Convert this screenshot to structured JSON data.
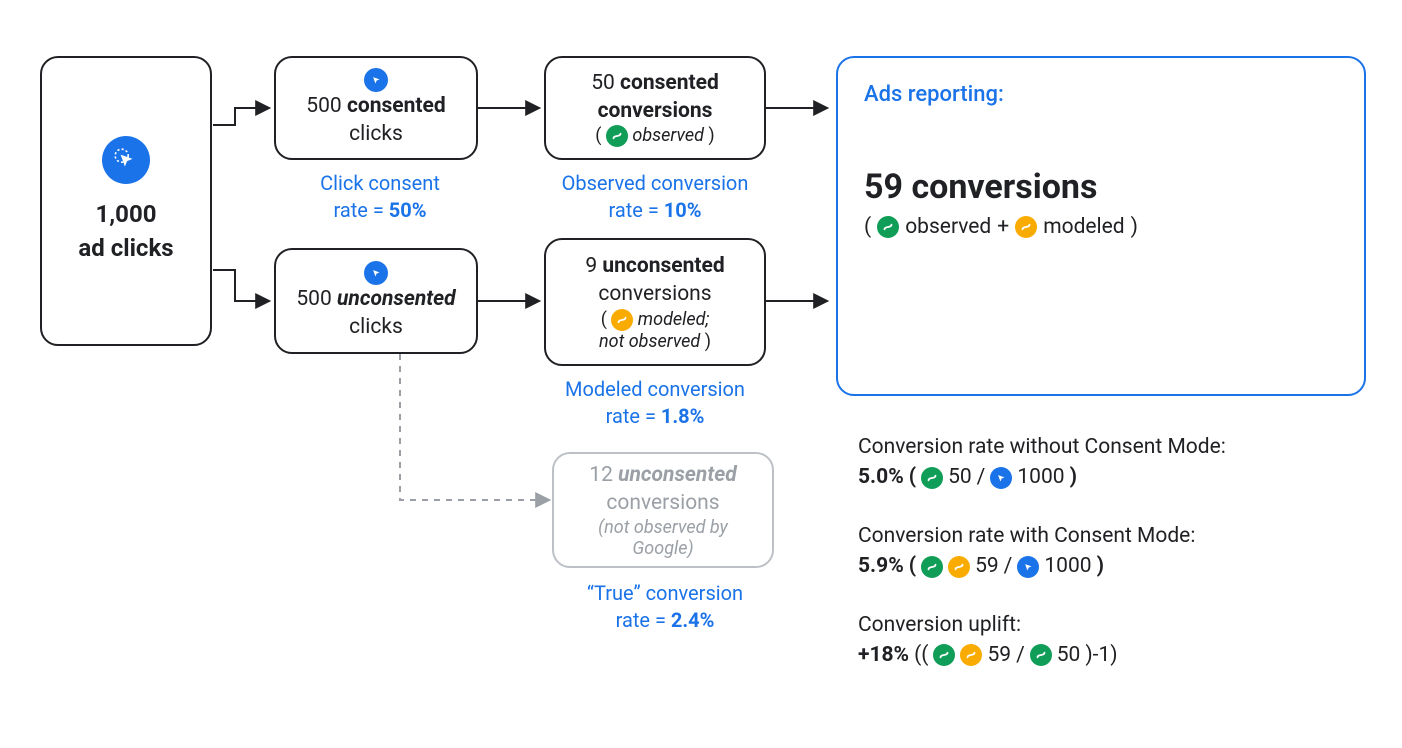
{
  "source": {
    "count": "1,000",
    "label": "ad clicks"
  },
  "consented_clicks": {
    "count": "500",
    "strong": "consented",
    "word": "clicks"
  },
  "unconsented_clicks": {
    "count": "500",
    "strong": "unconsented",
    "word": "clicks"
  },
  "consented_conv": {
    "count": "50",
    "strong": "consented",
    "word": "conversions",
    "note": "observed"
  },
  "unconsented_conv_modeled": {
    "count": "9",
    "strong": "unconsented",
    "word": "conversions",
    "note": "modeled;",
    "note2": "not observed"
  },
  "unconsented_conv_true": {
    "count": "12",
    "strong": "unconsented",
    "word": "conversions",
    "note": "(not observed by Google)"
  },
  "captions": {
    "click_consent": {
      "label": "Click consent",
      "line2": "rate = ",
      "val": "50%"
    },
    "observed": {
      "label": "Observed conversion",
      "line2": "rate = ",
      "val": "10%"
    },
    "modeled": {
      "label": "Modeled conversion",
      "line2": "rate = ",
      "val": "1.8%"
    },
    "true": {
      "label": "“True” conversion",
      "line2": "rate = ",
      "val": "2.4%"
    }
  },
  "reporting": {
    "title": "Ads reporting:",
    "big_count": "59 conversions",
    "note_obs": "observed",
    "note_plus": " + ",
    "note_mod": "modeled"
  },
  "stats": {
    "without_label": "Conversion rate without Consent Mode:",
    "without_pct": "5.0%",
    "without_a": "50",
    "without_b": "1000",
    "with_label": "Conversion rate with Consent Mode:",
    "with_pct": "5.9%",
    "with_a": "59",
    "with_b": "1000",
    "uplift_label": "Conversion uplift:",
    "uplift_pct": "+18%",
    "uplift_a": "59",
    "uplift_b": "50"
  }
}
